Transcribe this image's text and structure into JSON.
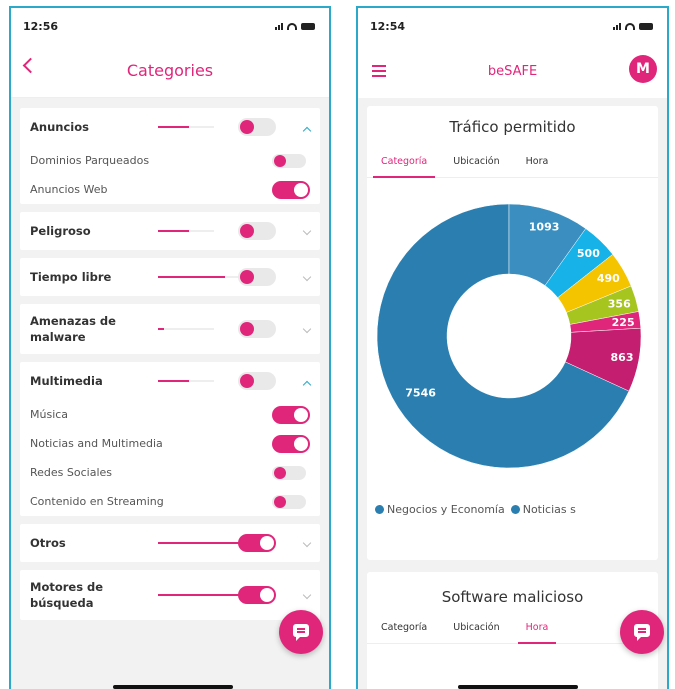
{
  "left": {
    "status": {
      "time": "12:56"
    },
    "header": {
      "title": "Categories"
    },
    "categories": [
      {
        "name": "Anuncios",
        "level": 0.55,
        "enabled": false,
        "expanded": true,
        "subs": [
          {
            "name": "Dominios Parqueados",
            "enabled": false
          },
          {
            "name": "Anuncios Web",
            "enabled": true
          }
        ]
      },
      {
        "name": "Peligroso",
        "level": 0.55,
        "enabled": false,
        "expanded": false,
        "subs": []
      },
      {
        "name": "Tiempo libre",
        "level": 0.8,
        "enabled": false,
        "expanded": false,
        "subs": []
      },
      {
        "name": "Amenazas de malware",
        "level": 0.1,
        "enabled": false,
        "expanded": false,
        "subs": []
      },
      {
        "name": "Multimedia",
        "level": 0.55,
        "enabled": false,
        "expanded": true,
        "subs": [
          {
            "name": "Música",
            "enabled": true
          },
          {
            "name": "Noticias and Multimedia",
            "enabled": true
          },
          {
            "name": "Redes Sociales",
            "enabled": false
          },
          {
            "name": "Contenido en Streaming",
            "enabled": false
          }
        ]
      },
      {
        "name": "Otros",
        "level": 1.0,
        "enabled": true,
        "expanded": false,
        "subs": []
      },
      {
        "name": "Motores de búsqueda",
        "level": 1.0,
        "enabled": true,
        "expanded": false,
        "subs": []
      }
    ]
  },
  "right": {
    "status": {
      "time": "12:54"
    },
    "header": {
      "title": "beSAFE",
      "avatar": "M"
    },
    "panel1": {
      "title": "Tráfico permitido",
      "tabs": [
        "Categoría",
        "Ubicación",
        "Hora"
      ],
      "active_tab": 0
    },
    "panel2": {
      "title": "Software malicioso",
      "tabs": [
        "Categoría",
        "Ubicación",
        "Hora"
      ],
      "active_tab": 2
    },
    "legend": [
      {
        "label": "Negocios y Economía",
        "color": "#2b7fb0"
      },
      {
        "label": "Noticias s",
        "color": "#2b7fb0"
      }
    ]
  },
  "chart_data": {
    "type": "pie",
    "donut": true,
    "title": "Tráfico permitido",
    "values": [
      7546,
      1093,
      500,
      490,
      356,
      225,
      863
    ],
    "colors": [
      "#2b7fb0",
      "#3a8fc0",
      "#17b2e8",
      "#f5c400",
      "#a6c51e",
      "#e0267b",
      "#c41e70"
    ],
    "labels": [
      "7546",
      "1093",
      "500",
      "490",
      "356",
      "225",
      "863"
    ]
  },
  "colors": {
    "accent": "#e0267b",
    "frame": "#2ba9c9"
  }
}
